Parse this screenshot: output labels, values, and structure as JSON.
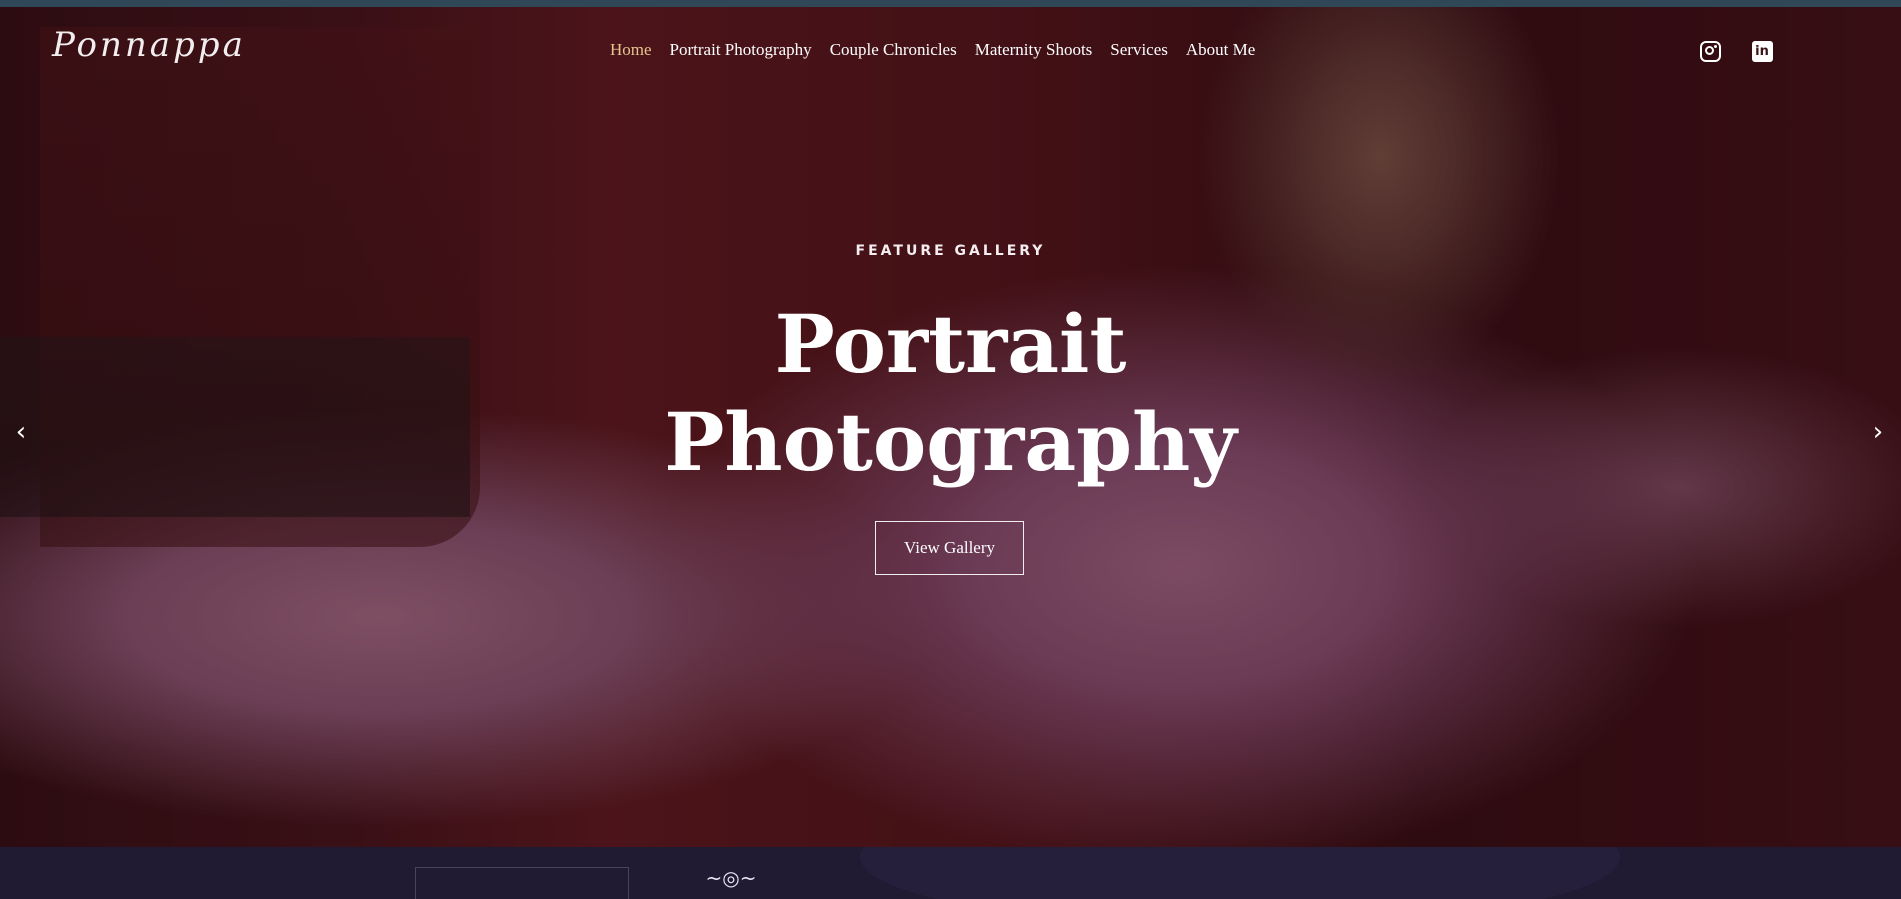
{
  "brand": {
    "logo_text": "Ponnappa"
  },
  "nav": {
    "items": [
      {
        "label": "Home",
        "active": true
      },
      {
        "label": "Portrait Photography",
        "active": false
      },
      {
        "label": "Couple Chronicles",
        "active": false
      },
      {
        "label": "Maternity Shoots",
        "active": false
      },
      {
        "label": "Services",
        "active": false
      },
      {
        "label": "About Me",
        "active": false
      }
    ],
    "active_color": "#e8c48e"
  },
  "social": [
    {
      "icon": "instagram-icon"
    },
    {
      "icon": "linkedin-icon",
      "glyph": "in"
    }
  ],
  "hero": {
    "kicker": "FEATURE GALLERY",
    "title_line1": "Portrait",
    "title_line2": "Photography",
    "cta_label": "View Gallery",
    "prev_glyph": "‹",
    "next_glyph": "›"
  },
  "footer_preview": {
    "ornament_icon": "camera-ornament-icon",
    "ornament_glyph": "~◎~"
  },
  "colors": {
    "top_strip": "#2f4757",
    "bottom_section": "#201a33"
  }
}
